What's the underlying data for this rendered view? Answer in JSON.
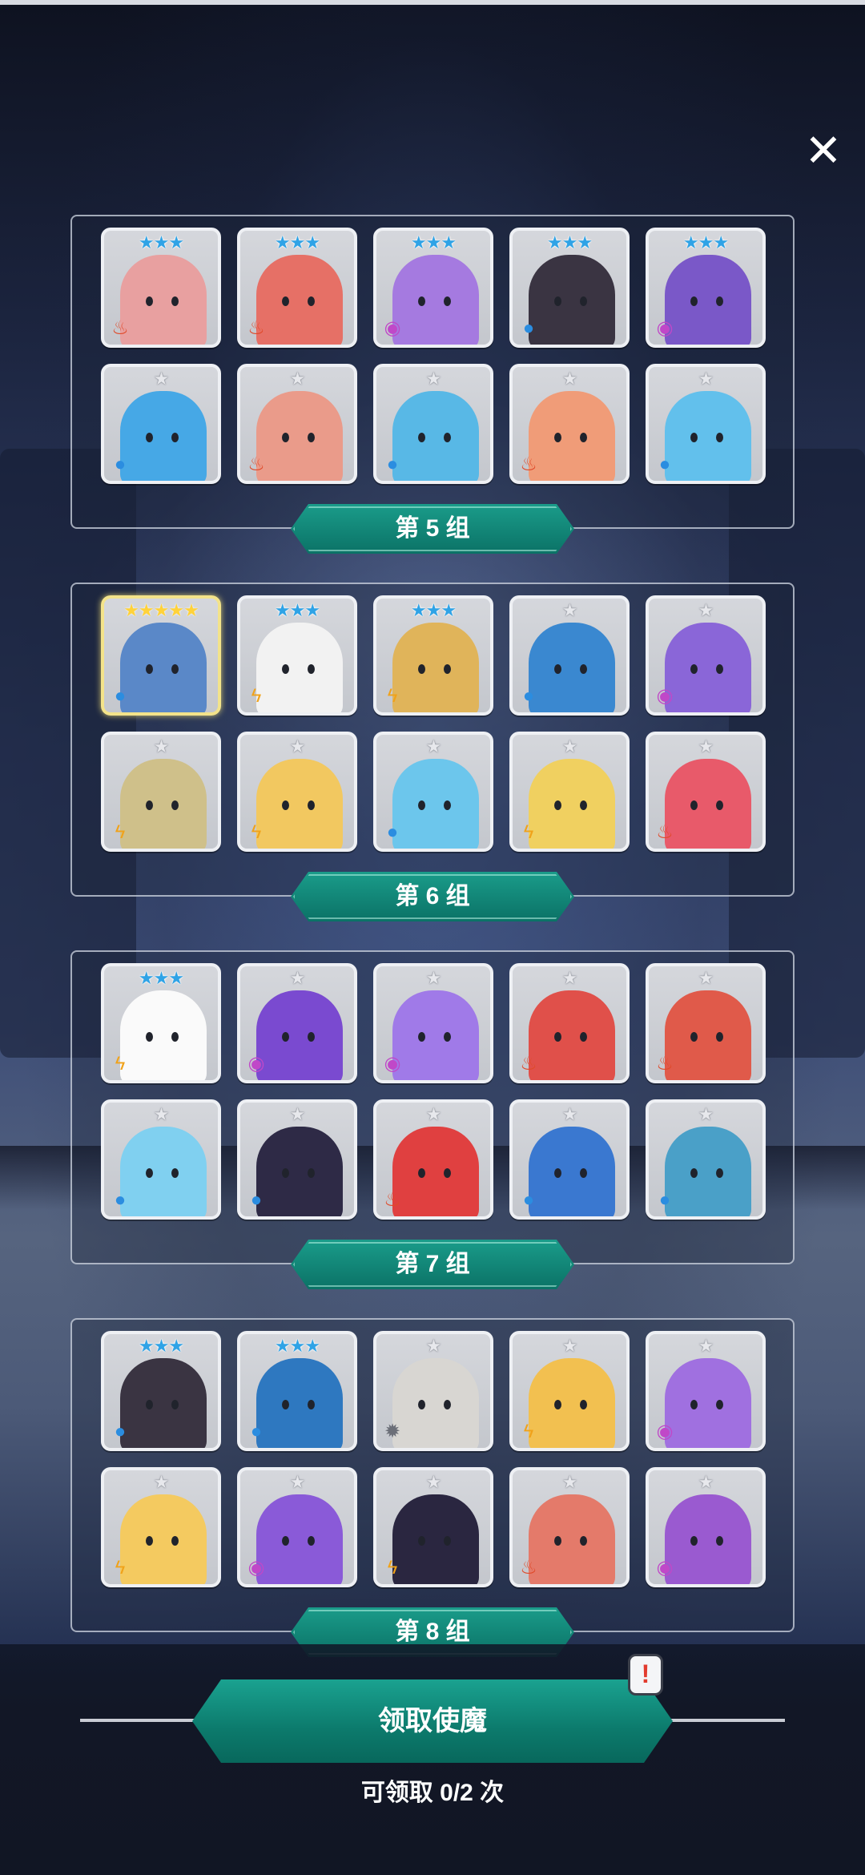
{
  "close_label": "✕",
  "groups": [
    {
      "label": "第 5 组",
      "cards": [
        {
          "stars": "★★★",
          "star_type": "blue",
          "element": "fire",
          "body": "#e8a0a0"
        },
        {
          "stars": "★★★",
          "star_type": "blue",
          "element": "fire",
          "body": "#e67066"
        },
        {
          "stars": "★★★",
          "star_type": "blue",
          "element": "dark",
          "body": "#a57ae0"
        },
        {
          "stars": "★★★",
          "star_type": "blue",
          "element": "water",
          "body": "#3a3442"
        },
        {
          "stars": "★★★",
          "star_type": "blue",
          "element": "dark",
          "body": "#7a58c8"
        },
        {
          "stars": "★",
          "star_type": "white",
          "element": "water",
          "body": "#46a8e6"
        },
        {
          "stars": "★",
          "star_type": "white",
          "element": "fire",
          "body": "#ea9b8a"
        },
        {
          "stars": "★",
          "star_type": "white",
          "element": "water",
          "body": "#58b8e6"
        },
        {
          "stars": "★",
          "star_type": "white",
          "element": "fire",
          "body": "#f09c78"
        },
        {
          "stars": "★",
          "star_type": "white",
          "element": "water",
          "body": "#62c0ec"
        }
      ]
    },
    {
      "label": "第 6 组",
      "cards": [
        {
          "stars": "★★★★★",
          "star_type": "gold",
          "element": "water",
          "body": "#5a88c8",
          "gold": true
        },
        {
          "stars": "★★★",
          "star_type": "blue",
          "element": "light",
          "body": "#f2f2f2"
        },
        {
          "stars": "★★★",
          "star_type": "blue",
          "element": "light",
          "body": "#e0b45a"
        },
        {
          "stars": "★",
          "star_type": "white",
          "element": "water",
          "body": "#3a88d0"
        },
        {
          "stars": "★",
          "star_type": "white",
          "element": "dark",
          "body": "#8a66d8"
        },
        {
          "stars": "★",
          "star_type": "white",
          "element": "light",
          "body": "#cfc08a"
        },
        {
          "stars": "★",
          "star_type": "white",
          "element": "light",
          "body": "#f2c860"
        },
        {
          "stars": "★",
          "star_type": "white",
          "element": "water",
          "body": "#6cc6ec"
        },
        {
          "stars": "★",
          "star_type": "white",
          "element": "light",
          "body": "#f0d060"
        },
        {
          "stars": "★",
          "star_type": "white",
          "element": "fire",
          "body": "#e85a6a"
        }
      ]
    },
    {
      "label": "第 7 组",
      "cards": [
        {
          "stars": "★★★",
          "star_type": "blue",
          "element": "light",
          "body": "#fafafa"
        },
        {
          "stars": "★",
          "star_type": "white",
          "element": "dark",
          "body": "#7a4ad0"
        },
        {
          "stars": "★",
          "star_type": "white",
          "element": "dark",
          "body": "#a07ae8"
        },
        {
          "stars": "★",
          "star_type": "white",
          "element": "fire",
          "body": "#e0504a"
        },
        {
          "stars": "★",
          "star_type": "white",
          "element": "fire",
          "body": "#e05a4a"
        },
        {
          "stars": "★",
          "star_type": "white",
          "element": "water",
          "body": "#80d0f0"
        },
        {
          "stars": "★",
          "star_type": "white",
          "element": "water",
          "body": "#2e2a46"
        },
        {
          "stars": "★",
          "star_type": "white",
          "element": "fire",
          "body": "#e04040"
        },
        {
          "stars": "★",
          "star_type": "white",
          "element": "water",
          "body": "#3a78d0"
        },
        {
          "stars": "★",
          "star_type": "white",
          "element": "water",
          "body": "#4aa0c8"
        }
      ]
    },
    {
      "label": "第 8 组",
      "cards": [
        {
          "stars": "★★★",
          "star_type": "blue",
          "element": "water",
          "body": "#3a3442"
        },
        {
          "stars": "★★★",
          "star_type": "blue",
          "element": "water",
          "body": "#2e78c0"
        },
        {
          "stars": "★",
          "star_type": "white",
          "element": "neutral",
          "body": "#d8d6d2"
        },
        {
          "stars": "★",
          "star_type": "white",
          "element": "light",
          "body": "#f2c050"
        },
        {
          "stars": "★",
          "star_type": "white",
          "element": "dark",
          "body": "#a070e0"
        },
        {
          "stars": "★",
          "star_type": "white",
          "element": "light",
          "body": "#f4ca60"
        },
        {
          "stars": "★",
          "star_type": "white",
          "element": "dark",
          "body": "#8a5ad8"
        },
        {
          "stars": "★",
          "star_type": "white",
          "element": "light",
          "body": "#2a2640"
        },
        {
          "stars": "★",
          "star_type": "white",
          "element": "fire",
          "body": "#e47a6a"
        },
        {
          "stars": "★",
          "star_type": "white",
          "element": "dark",
          "body": "#9a5ad0"
        }
      ]
    }
  ],
  "claim": {
    "button_label": "领取使魔",
    "badge": "!",
    "count_text": "可领取 0/2 次"
  },
  "colors": {
    "accent_teal": "#0f7d6f",
    "fire": "#e04a2a",
    "water": "#2b8de0",
    "dark": "#c048c8",
    "light": "#f0a21a"
  },
  "element_icons": {
    "fire": "fire-icon",
    "water": "water-drop-icon",
    "dark": "swirl-icon",
    "light": "lightning-icon",
    "neutral": "gear-icon"
  }
}
